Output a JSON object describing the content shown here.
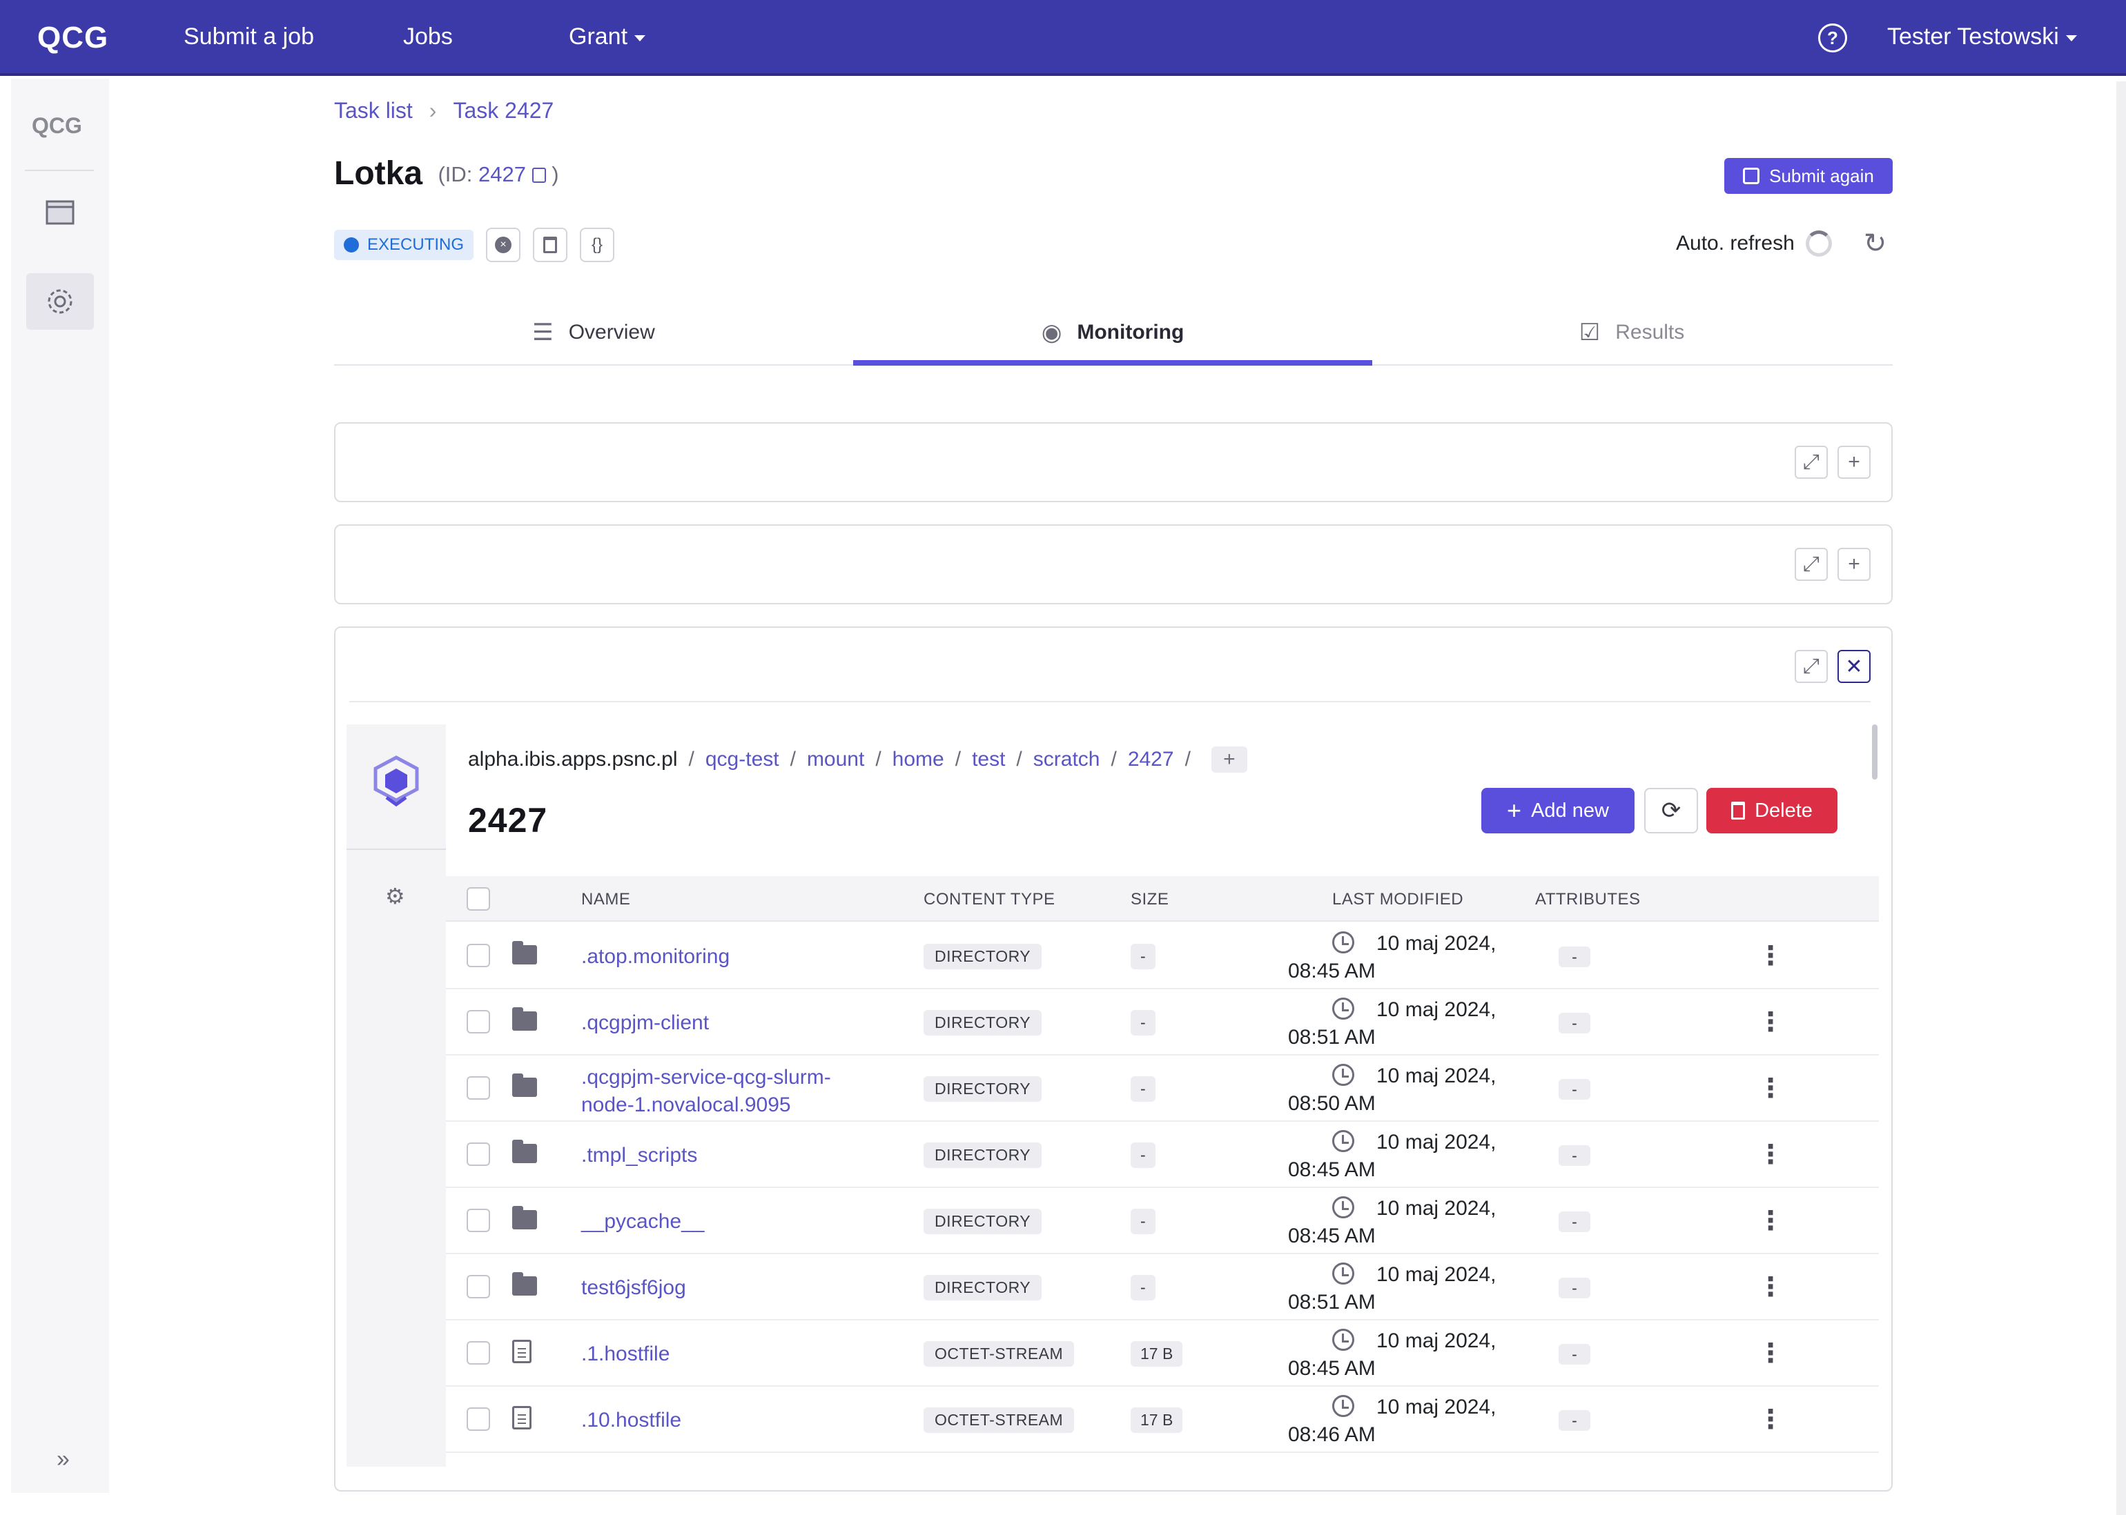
{
  "nav": {
    "brand": "QCG",
    "items": [
      "Submit a job",
      "Jobs",
      "Grant"
    ],
    "user": "Tester Testowski"
  },
  "rail": {
    "logo": "QCG"
  },
  "breadcrumb": {
    "items": [
      "Task list",
      "Task 2427"
    ]
  },
  "task": {
    "title": "Lotka",
    "id_prefix": "(ID: ",
    "id": "2427",
    "id_suffix": ")",
    "status": "EXECUTING",
    "submit_again": "Submit again",
    "auto_refresh": "Auto. refresh",
    "auto_refresh_seconds": "10"
  },
  "tabs": [
    {
      "label": "Overview",
      "icon": "list-icon"
    },
    {
      "label": "Monitoring",
      "icon": "eye-icon"
    },
    {
      "label": "Results",
      "icon": "checkbox-icon"
    }
  ],
  "active_tab": "Monitoring",
  "file_browser": {
    "path": [
      "alpha.ibis.apps.psnc.pl",
      "qcg-test",
      "mount",
      "home",
      "test",
      "scratch",
      "2427"
    ],
    "current_dir": "2427",
    "add_label": "Add new",
    "delete_label": "Delete",
    "columns": [
      "NAME",
      "CONTENT TYPE",
      "SIZE",
      "LAST MODIFIED",
      "ATTRIBUTES"
    ],
    "rows": [
      {
        "name": ".atop.monitoring",
        "type": "DIRECTORY",
        "size": "-",
        "modified_date": "10 maj 2024,",
        "modified_time": "08:45 AM",
        "attr": "-",
        "kind": "folder"
      },
      {
        "name": ".qcgpjm-client",
        "type": "DIRECTORY",
        "size": "-",
        "modified_date": "10 maj 2024,",
        "modified_time": "08:51 AM",
        "attr": "-",
        "kind": "folder"
      },
      {
        "name": ".qcgpjm-service-qcg-slurm-node-1.novalocal.9095",
        "name_line1": ".qcgpjm-service-qcg-slurm-",
        "name_line2": "node-1.novalocal.9095",
        "type": "DIRECTORY",
        "size": "-",
        "modified_date": "10 maj 2024,",
        "modified_time": "08:50 AM",
        "attr": "-",
        "kind": "folder"
      },
      {
        "name": ".tmpl_scripts",
        "type": "DIRECTORY",
        "size": "-",
        "modified_date": "10 maj 2024,",
        "modified_time": "08:45 AM",
        "attr": "-",
        "kind": "folder"
      },
      {
        "name": "__pycache__",
        "type": "DIRECTORY",
        "size": "-",
        "modified_date": "10 maj 2024,",
        "modified_time": "08:45 AM",
        "attr": "-",
        "kind": "folder"
      },
      {
        "name": "test6jsf6jog",
        "type": "DIRECTORY",
        "size": "-",
        "modified_date": "10 maj 2024,",
        "modified_time": "08:51 AM",
        "attr": "-",
        "kind": "folder"
      },
      {
        "name": ".1.hostfile",
        "type": "OCTET-STREAM",
        "size": "17 B",
        "modified_date": "10 maj 2024,",
        "modified_time": "08:45 AM",
        "attr": "-",
        "kind": "file"
      },
      {
        "name": ".10.hostfile",
        "type": "OCTET-STREAM",
        "size": "17 B",
        "modified_date": "10 maj 2024,",
        "modified_time": "08:46 AM",
        "attr": "-",
        "kind": "file"
      }
    ]
  },
  "colors": {
    "primary": "#3b3aa8",
    "accent": "#5a4fdc",
    "danger": "#dc2f45",
    "info": "#1f6dd8"
  }
}
